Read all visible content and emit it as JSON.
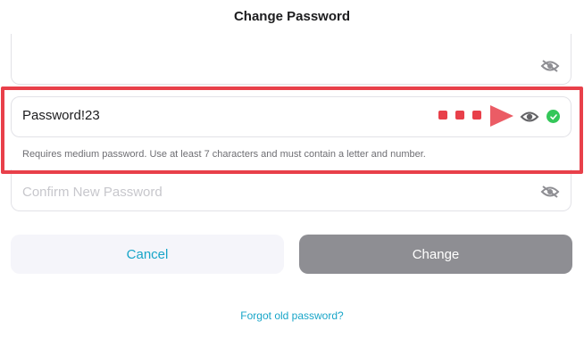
{
  "header": {
    "title": "Change Password"
  },
  "current_password": {
    "value": "",
    "icon": "eye-slash-icon"
  },
  "new_password": {
    "value": "Password!23",
    "icon": "eye-icon",
    "status": "valid",
    "hint": "Requires medium password. Use at least 7 characters and must contain a letter and number."
  },
  "confirm_password": {
    "placeholder": "Confirm New Password",
    "icon": "eye-slash-icon"
  },
  "buttons": {
    "cancel_label": "Cancel",
    "change_label": "Change"
  },
  "links": {
    "forgot_label": "Forgot old password?"
  },
  "colors": {
    "accent": "#17a5c8",
    "highlight": "#e8404a",
    "valid": "#34c759",
    "disabled_button": "#8e8e93"
  }
}
